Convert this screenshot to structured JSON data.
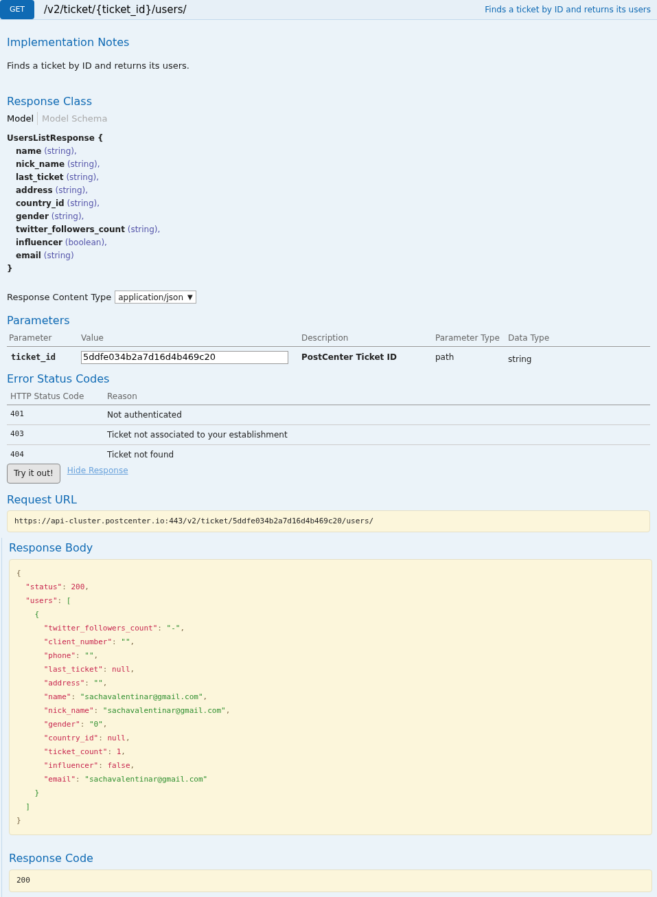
{
  "operation": {
    "method": "GET",
    "path": "/v2/ticket/{ticket_id}/users/",
    "summary": "Finds a ticket by ID and returns its users"
  },
  "implementation_notes": {
    "heading": "Implementation Notes",
    "text": "Finds a ticket by ID and returns its users."
  },
  "response_class": {
    "heading": "Response Class",
    "tabs": [
      {
        "label": "Model",
        "selected": true
      },
      {
        "label": "Model Schema",
        "selected": false
      }
    ],
    "model": {
      "name": "UsersListResponse",
      "open": "{",
      "close": "}",
      "properties": [
        {
          "name": "name",
          "type": "(string),"
        },
        {
          "name": "nick_name",
          "type": "(string),"
        },
        {
          "name": "last_ticket",
          "type": "(string),"
        },
        {
          "name": "address",
          "type": "(string),"
        },
        {
          "name": "country_id",
          "type": "(string),"
        },
        {
          "name": "gender",
          "type": "(string),"
        },
        {
          "name": "twitter_followers_count",
          "type": "(string),"
        },
        {
          "name": "influencer",
          "type": "(boolean),"
        },
        {
          "name": "email",
          "type": "(string)"
        }
      ]
    }
  },
  "content_type": {
    "label": "Response Content Type",
    "value": "application/json",
    "caret": "▼"
  },
  "parameters": {
    "heading": "Parameters",
    "columns": [
      "Parameter",
      "Value",
      "Description",
      "Parameter Type",
      "Data Type"
    ],
    "rows": [
      {
        "name": "ticket_id",
        "value": "5ddfe034b2a7d16d4b469c20",
        "description": "PostCenter Ticket ID",
        "parameter_type": "path",
        "data_type": "string"
      }
    ]
  },
  "error_codes": {
    "heading": "Error Status Codes",
    "columns": [
      "HTTP Status Code",
      "Reason"
    ],
    "rows": [
      {
        "code": "401",
        "reason": "Not authenticated"
      },
      {
        "code": "403",
        "reason": "Ticket not associated to your establishment"
      },
      {
        "code": "404",
        "reason": "Ticket not found"
      }
    ]
  },
  "try_button": "Try it out!",
  "hide_link": "Hide Response",
  "request_url": {
    "heading": "Request URL",
    "value": "https://api-cluster.postcenter.io:443/v2/ticket/5ddfe034b2a7d16d4b469c20/users/"
  },
  "response_body": {
    "heading": "Response Body",
    "lines": [
      [
        {
          "kind": "punct",
          "text": "{"
        }
      ],
      [
        {
          "kind": "key",
          "text": "  \"status\""
        },
        {
          "kind": "punct",
          "text": ": "
        },
        {
          "kind": "number",
          "text": "200"
        },
        {
          "kind": "punct",
          "text": ","
        }
      ],
      [
        {
          "kind": "key",
          "text": "  \"users\""
        },
        {
          "kind": "punct",
          "text": ": "
        },
        {
          "kind": "bracket",
          "text": "["
        }
      ],
      [
        {
          "kind": "bracket",
          "text": "    {"
        }
      ],
      [
        {
          "kind": "key",
          "text": "      \"twitter_followers_count\""
        },
        {
          "kind": "punct",
          "text": ": "
        },
        {
          "kind": "string",
          "text": "\"-\""
        },
        {
          "kind": "punct",
          "text": ","
        }
      ],
      [
        {
          "kind": "key",
          "text": "      \"client_number\""
        },
        {
          "kind": "punct",
          "text": ": "
        },
        {
          "kind": "string",
          "text": "\"\""
        },
        {
          "kind": "punct",
          "text": ","
        }
      ],
      [
        {
          "kind": "key",
          "text": "      \"phone\""
        },
        {
          "kind": "punct",
          "text": ": "
        },
        {
          "kind": "string",
          "text": "\"\""
        },
        {
          "kind": "punct",
          "text": ","
        }
      ],
      [
        {
          "kind": "key",
          "text": "      \"last_ticket\""
        },
        {
          "kind": "punct",
          "text": ": "
        },
        {
          "kind": "number",
          "text": "null"
        },
        {
          "kind": "punct",
          "text": ","
        }
      ],
      [
        {
          "kind": "key",
          "text": "      \"address\""
        },
        {
          "kind": "punct",
          "text": ": "
        },
        {
          "kind": "string",
          "text": "\"\""
        },
        {
          "kind": "punct",
          "text": ","
        }
      ],
      [
        {
          "kind": "key",
          "text": "      \"name\""
        },
        {
          "kind": "punct",
          "text": ": "
        },
        {
          "kind": "string",
          "text": "\"sachavalentinar@gmail.com\""
        },
        {
          "kind": "punct",
          "text": ","
        }
      ],
      [
        {
          "kind": "key",
          "text": "      \"nick_name\""
        },
        {
          "kind": "punct",
          "text": ": "
        },
        {
          "kind": "string",
          "text": "\"sachavalentinar@gmail.com\""
        },
        {
          "kind": "punct",
          "text": ","
        }
      ],
      [
        {
          "kind": "key",
          "text": "      \"gender\""
        },
        {
          "kind": "punct",
          "text": ": "
        },
        {
          "kind": "string",
          "text": "\"0\""
        },
        {
          "kind": "punct",
          "text": ","
        }
      ],
      [
        {
          "kind": "key",
          "text": "      \"country_id\""
        },
        {
          "kind": "punct",
          "text": ": "
        },
        {
          "kind": "number",
          "text": "null"
        },
        {
          "kind": "punct",
          "text": ","
        }
      ],
      [
        {
          "kind": "key",
          "text": "      \"ticket_count\""
        },
        {
          "kind": "punct",
          "text": ": "
        },
        {
          "kind": "number",
          "text": "1"
        },
        {
          "kind": "punct",
          "text": ","
        }
      ],
      [
        {
          "kind": "key",
          "text": "      \"influencer\""
        },
        {
          "kind": "punct",
          "text": ": "
        },
        {
          "kind": "number",
          "text": "false"
        },
        {
          "kind": "punct",
          "text": ","
        }
      ],
      [
        {
          "kind": "key",
          "text": "      \"email\""
        },
        {
          "kind": "punct",
          "text": ": "
        },
        {
          "kind": "string",
          "text": "\"sachavalentinar@gmail.com\""
        }
      ],
      [
        {
          "kind": "bracket",
          "text": "    }"
        }
      ],
      [
        {
          "kind": "bracket",
          "text": "  ]"
        }
      ],
      [
        {
          "kind": "punct",
          "text": "}"
        }
      ]
    ]
  },
  "response_code": {
    "heading": "Response Code",
    "value": "200"
  }
}
